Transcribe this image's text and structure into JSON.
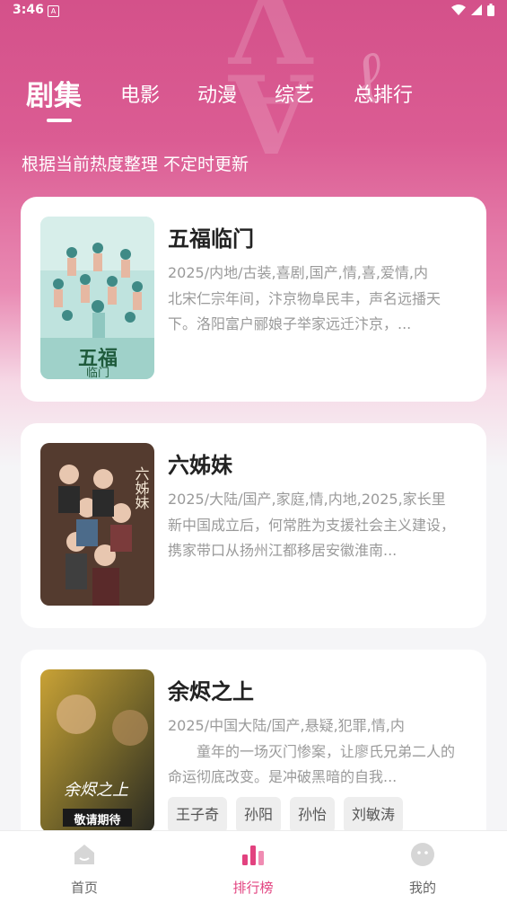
{
  "status_bar": {
    "time": "3:46",
    "notification_letter": "A"
  },
  "tabs": [
    {
      "label": "剧集",
      "active": true
    },
    {
      "label": "电影",
      "active": false
    },
    {
      "label": "动漫",
      "active": false
    },
    {
      "label": "综艺",
      "active": false
    },
    {
      "label": "总排行",
      "active": false
    }
  ],
  "subtitle": "根据当前热度整理 不定时更新",
  "items": [
    {
      "title": "五福临门",
      "tags": "2025/内地/古装,喜剧,国产,情,喜,爱情,内",
      "desc": "北宋仁宗年间，汴京物阜民丰，声名远播天下。洛阳富户郦娘子举家远迁汴京，...",
      "poster_text": "五福临门",
      "actors": []
    },
    {
      "title": "六姊妹",
      "tags": "2025/大陆/国产,家庭,情,内地,2025,家长里",
      "desc": "新中国成立后，何常胜为支援社会主义建设，携家带口从扬州江都移居安徽淮南...",
      "poster_text": "六姊妹",
      "actors": []
    },
    {
      "title": "余烬之上",
      "tags": "2025/中国大陆/国产,悬疑,犯罪,情,内",
      "desc": "　　童年的一场灭门惨案，让廖氏兄弟二人的命运彻底改变。是冲破黑暗的自我...",
      "poster_text": "余烬之上",
      "poster_badge": "敬请期待",
      "actors": [
        "王子奇",
        "孙阳",
        "孙怡",
        "刘敏涛"
      ]
    }
  ],
  "bottom_nav": [
    {
      "label": "首页",
      "icon": "home-icon",
      "active": false
    },
    {
      "label": "排行榜",
      "icon": "ranking-icon",
      "active": true
    },
    {
      "label": "我的",
      "icon": "profile-icon",
      "active": false
    }
  ],
  "colors": {
    "accent": "#e2427f",
    "hero_top": "#d4518a",
    "background": "#f5f5f7"
  }
}
